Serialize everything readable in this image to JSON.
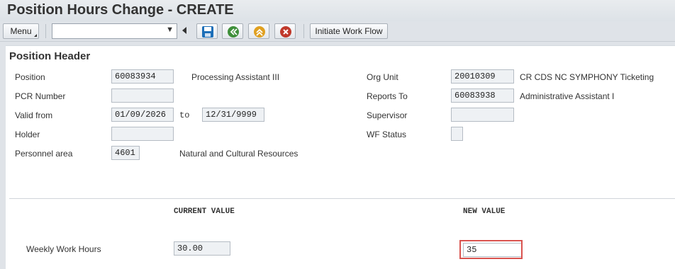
{
  "window": {
    "title": "Position Hours Change - CREATE"
  },
  "toolbar": {
    "menu_label": "Menu",
    "command_field_value": "",
    "icons": [
      "save-icon",
      "back-icon",
      "exit-icon",
      "cancel-icon"
    ],
    "workflow_button_label": "Initiate Work Flow"
  },
  "header": {
    "section_title": "Position Header",
    "position": {
      "label": "Position",
      "value": "60083934",
      "text": "Processing Assistant III"
    },
    "pcr_number": {
      "label": "PCR Number",
      "value": ""
    },
    "valid_from": {
      "label": "Valid from",
      "value": "01/09/2026",
      "to_label": "to",
      "to_value": "12/31/9999"
    },
    "holder": {
      "label": "Holder",
      "value": ""
    },
    "personnel_area": {
      "label": "Personnel area",
      "value": "4601",
      "text": "Natural and Cultural Resources"
    },
    "org_unit": {
      "label": "Org Unit",
      "value": "20010309",
      "text": "CR CDS NC SYMPHONY Ticketing"
    },
    "reports_to": {
      "label": "Reports To",
      "value": "60083938",
      "text": "Administrative Assistant I"
    },
    "supervisor": {
      "label": "Supervisor",
      "value": ""
    },
    "wf_status": {
      "label": "WF Status",
      "value": ""
    }
  },
  "change": {
    "current_header": "CURRENT VALUE",
    "new_header": "NEW VALUE",
    "weekly_hours": {
      "label": "Weekly Work Hours",
      "current": "30.00",
      "new": "35"
    }
  },
  "colors": {
    "highlight": "#d9534f",
    "save": "#1d6fb8",
    "back": "#3f8f3a",
    "exit": "#e0a020",
    "cancel": "#c0392b"
  }
}
